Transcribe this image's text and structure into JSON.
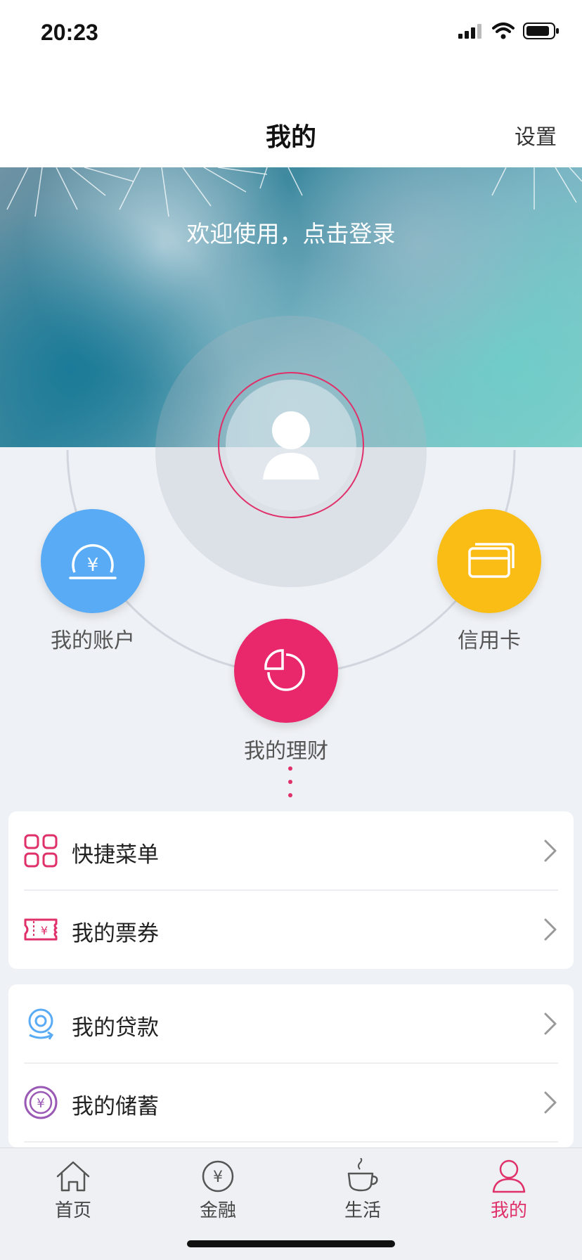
{
  "status_bar": {
    "time": "20:23"
  },
  "nav": {
    "title": "我的",
    "settings": "设置"
  },
  "hero": {
    "login_prompt": "欢迎使用，点击登录"
  },
  "quick_circles": {
    "account": {
      "label": "我的账户",
      "icon": "yuan-dial-icon",
      "color": "#5aabf5"
    },
    "credit": {
      "label": "信用卡",
      "icon": "cards-icon",
      "color": "#f9bd16"
    },
    "wealth": {
      "label": "我的理财",
      "icon": "pie-chart-icon",
      "color": "#e8286a"
    }
  },
  "menu_group_1": [
    {
      "label": "快捷菜单",
      "icon": "grid-icon"
    },
    {
      "label": "我的票券",
      "icon": "ticket-icon"
    }
  ],
  "menu_group_2": [
    {
      "label": "我的贷款",
      "icon": "loan-icon"
    },
    {
      "label": "我的储蓄",
      "icon": "savings-icon"
    }
  ],
  "tabs": [
    {
      "label": "首页",
      "icon": "home-icon",
      "active": false
    },
    {
      "label": "金融",
      "icon": "yuan-icon",
      "active": false
    },
    {
      "label": "生活",
      "icon": "cup-icon",
      "active": false
    },
    {
      "label": "我的",
      "icon": "user-icon",
      "active": true
    }
  ],
  "colors": {
    "accent": "#e0306a",
    "background": "#eef1f5"
  }
}
